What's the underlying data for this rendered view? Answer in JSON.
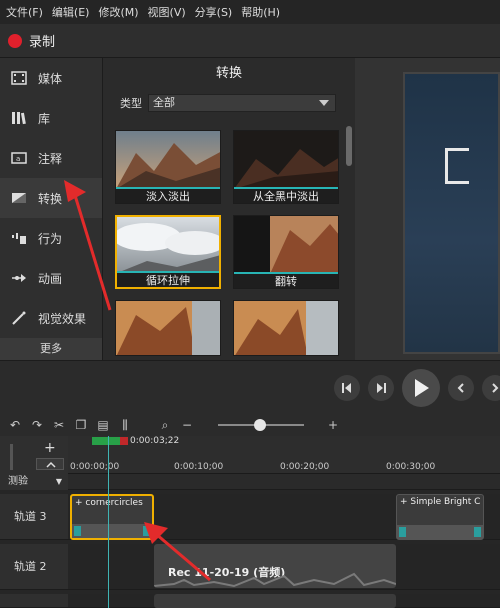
{
  "menu": [
    "文件(F)",
    "编辑(E)",
    "修改(M)",
    "视图(V)",
    "分享(S)",
    "帮助(H)"
  ],
  "record_label": "录制",
  "sidebar": {
    "items": [
      "媒体",
      "库",
      "注释",
      "转换",
      "行为",
      "动画",
      "视觉效果"
    ],
    "more": "更多"
  },
  "panel": {
    "title": "转换",
    "type_label": "类型",
    "type_value": "全部",
    "thumbs": [
      "淡入淡出",
      "从全黑中淡出",
      "循环拉伸",
      "翻转",
      "",
      ""
    ]
  },
  "timeline": {
    "time": "0:00:03;22",
    "ruler_labels": [
      "0:00:00;00",
      "0:00:10;00",
      "0:00:20;00",
      "0:00:30;00"
    ],
    "test_label": "测验",
    "tracks": [
      "轨道 3",
      "轨道 2"
    ],
    "clip_corner": "+ cornercircles",
    "clip_bright": "+ Simple Bright C",
    "audio_label": "Rec 11-20-19 (音频)"
  },
  "colors": {
    "accent": "#f0b000",
    "teal": "#28b4b4",
    "record": "#e0202c"
  }
}
